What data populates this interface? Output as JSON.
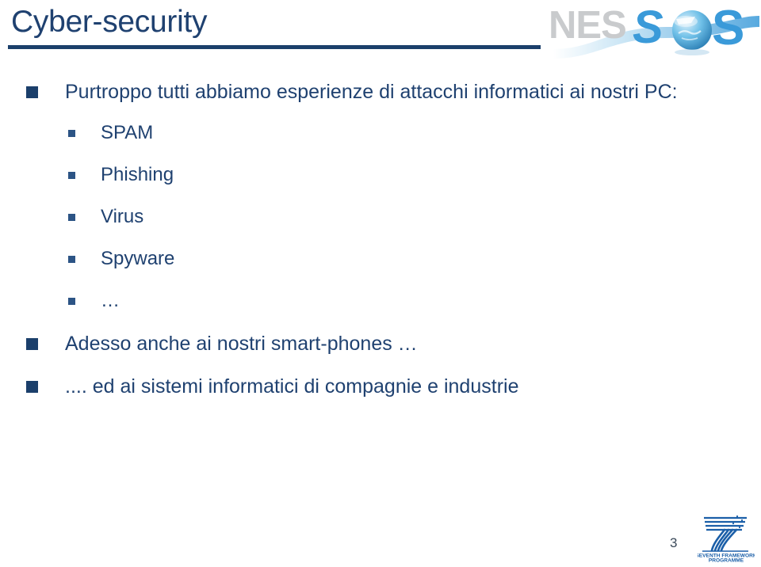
{
  "slide": {
    "title": "Cyber-security",
    "page_number": "3",
    "background_color": "#ffffff",
    "accent_color": "#1f4170",
    "rule_color": "#1b3f6b"
  },
  "logo_nessos": {
    "name": "nessos-logo",
    "text_gray": "NES",
    "text_blue_left": "S",
    "text_blue_right": "S",
    "gray_color": "#c9cbcd",
    "blue_color": "#3a9ad9"
  },
  "logo_fp7": {
    "name": "fp7-logo",
    "line1": "SEVENTH FRAMEWORK",
    "line2": "PROGRAMME",
    "numeral": "7",
    "color": "#1b5fa8"
  },
  "bullets": [
    {
      "level": 1,
      "text": "Purtroppo tutti abbiamo esperienze di attacchi informatici ai nostri PC:"
    },
    {
      "level": 2,
      "text": "SPAM"
    },
    {
      "level": 2,
      "text": "Phishing"
    },
    {
      "level": 2,
      "text": "Virus"
    },
    {
      "level": 2,
      "text": "Spyware"
    },
    {
      "level": 2,
      "text": "…"
    },
    {
      "level": 1,
      "text": "Adesso anche ai nostri smart-phones …"
    },
    {
      "level": 1,
      "text": ".... ed ai sistemi informatici di compagnie e industrie"
    }
  ],
  "bullet_text": {
    "b0": "Purtroppo tutti abbiamo esperienze di attacchi informatici ai nostri PC:",
    "b1": "SPAM",
    "b2": "Phishing",
    "b3": "Virus",
    "b4": "Spyware",
    "b5": "…",
    "b6": "Adesso anche ai nostri smart-phones …",
    "b7": ".... ed ai sistemi informatici di compagnie e industrie"
  }
}
